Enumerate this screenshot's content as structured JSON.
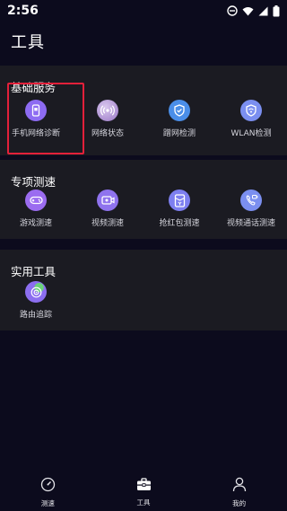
{
  "status_bar": {
    "time": "2:56"
  },
  "page": {
    "title": "工具"
  },
  "sections": [
    {
      "title": "基础服务",
      "items": [
        {
          "label": "手机网络诊断",
          "icon": "phone-diagnostic-icon",
          "color": "#8d6bf2"
        },
        {
          "label": "网络状态",
          "icon": "network-status-icon",
          "color": "#b79bd8"
        },
        {
          "label": "蹭网检测",
          "icon": "shield-check-icon",
          "color": "#4a8ee8"
        },
        {
          "label": "WLAN检测",
          "icon": "wlan-shield-icon",
          "color": "#7b8ff0"
        }
      ]
    },
    {
      "title": "专项测速",
      "items": [
        {
          "label": "游戏测速",
          "icon": "gamepad-icon",
          "color": "#9b6cf0"
        },
        {
          "label": "视频测速",
          "icon": "video-icon",
          "color": "#8f73ee"
        },
        {
          "label": "抢红包测速",
          "icon": "red-packet-icon",
          "color": "#7d7ff0"
        },
        {
          "label": "视频通话测速",
          "icon": "video-call-icon",
          "color": "#7b8ff0"
        }
      ]
    },
    {
      "title": "实用工具",
      "items": [
        {
          "label": "路由追踪",
          "icon": "route-trace-icon",
          "color": "#8c6ef0"
        }
      ]
    }
  ],
  "bottom_nav": [
    {
      "label": "测速",
      "icon": "speedometer-icon",
      "active": false
    },
    {
      "label": "工具",
      "icon": "toolbox-icon",
      "active": true
    },
    {
      "label": "我的",
      "icon": "person-icon",
      "active": false
    }
  ],
  "colors": {
    "background": "#0c0b1d",
    "section_background": "#1b1b22",
    "highlight": "#e3203a"
  }
}
